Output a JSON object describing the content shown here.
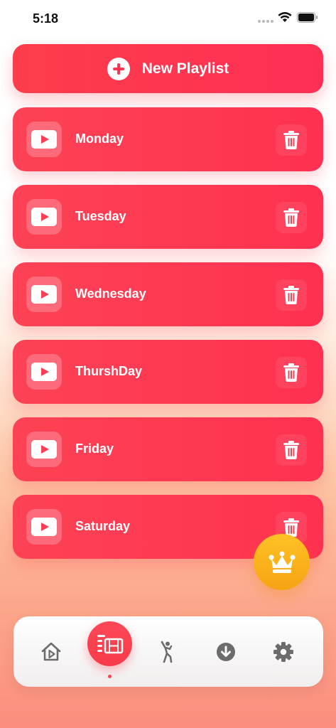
{
  "status_bar": {
    "time": "5:18"
  },
  "header": {
    "new_playlist_label": "New Playlist"
  },
  "playlists": [
    {
      "label": "Monday"
    },
    {
      "label": "Tuesday"
    },
    {
      "label": "Wednesday"
    },
    {
      "label": "ThurshDay"
    },
    {
      "label": "Friday"
    },
    {
      "label": "Saturday"
    }
  ],
  "tab_bar": {
    "tabs": [
      {
        "icon": "home-play-icon",
        "active": false
      },
      {
        "icon": "playlist-icon",
        "active": true
      },
      {
        "icon": "dance-icon",
        "active": false
      },
      {
        "icon": "download-icon",
        "active": false
      },
      {
        "icon": "gear-icon",
        "active": false
      }
    ]
  },
  "colors": {
    "accent": "#fe3550",
    "premium": "#fdb520",
    "tab_icon": "#6c6c6c"
  }
}
